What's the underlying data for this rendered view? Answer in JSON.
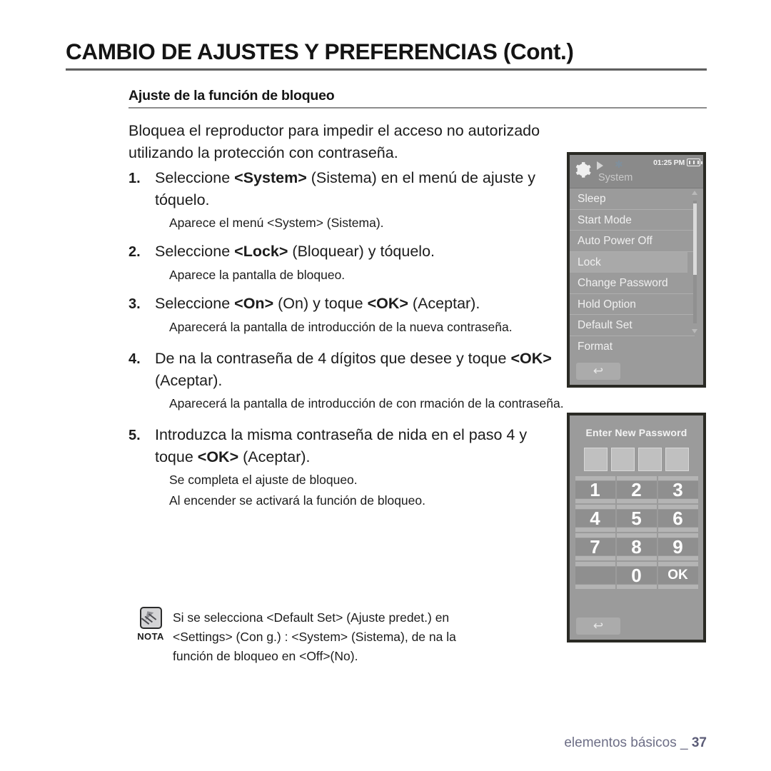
{
  "header": {
    "title": "CAMBIO DE AJUSTES Y PREFERENCIAS (Cont.)",
    "sub_heading": "Ajuste de la función de bloqueo"
  },
  "intro": "Bloquea el reproductor para impedir el acceso no autorizado utilizando la protección con contraseña.",
  "steps": [
    {
      "num": "1.",
      "text_1": "Seleccione ",
      "bold_1": "<System>",
      "text_2": " (Sistema) en el menú de ajuste y tóquelo.",
      "notes": [
        "Aparece el menú <System> (Sistema)."
      ]
    },
    {
      "num": "2.",
      "text_1": "Seleccione ",
      "bold_1": "<Lock>",
      "text_2": " (Bloquear) y tóquelo.",
      "notes": [
        "Aparece la pantalla de bloqueo."
      ]
    },
    {
      "num": "3.",
      "text_1": "Seleccione ",
      "bold_1": "<On>",
      "text_2": " (On) y toque ",
      "bold_2": "<OK>",
      "text_3": " (Aceptar).",
      "notes": [
        "Aparecerá la pantalla de introducción de la nueva contraseña."
      ]
    },
    {
      "num": "4.",
      "text_1": "De na la contraseña de 4 dígitos que desee y toque ",
      "bold_1": "<OK>",
      "text_2": " (Aceptar).",
      "notes": [
        "Aparecerá la pantalla de introducción de con rmación de la contraseña."
      ]
    },
    {
      "num": "5.",
      "text_1": "Introduzca la misma contraseña de nida en el paso 4 y toque ",
      "bold_1": "<OK>",
      "text_2": " (Aceptar).",
      "notes": [
        "Se completa el ajuste de bloqueo.",
        "Al encender se activará la función de bloqueo."
      ]
    }
  ],
  "note_block": {
    "icon": "note-hand-icon",
    "label": "NOTA",
    "line_1": "Si se selecciona <Default Set> (Ajuste predet.) en",
    "line_2": "<Settings> (Con g.)  :  <System> (Sistema), de na la",
    "line_3": "función de bloqueo en <Off>(No)."
  },
  "footer": {
    "text": "elementos básicos _",
    "page": "37",
    "color": "#6d6e86"
  },
  "device_menu": {
    "statusbar": {
      "gear_icon": "gear-icon",
      "play_icon": "play-icon",
      "bluetooth_icon": "bluetooth-icon",
      "time": "01:25 PM",
      "battery_icon": "battery-icon"
    },
    "screen_label": "System",
    "items": [
      {
        "label": "Sleep",
        "selected": false
      },
      {
        "label": "Start Mode",
        "selected": false
      },
      {
        "label": "Auto Power Off",
        "selected": false
      },
      {
        "label": "Lock",
        "selected": true
      },
      {
        "label": "Change Password",
        "selected": false
      },
      {
        "label": "Hold Option",
        "selected": false
      },
      {
        "label": "Default Set",
        "selected": false
      },
      {
        "label": "Format",
        "selected": false
      }
    ],
    "scroll_up_icon": "chevron-up-icon",
    "scroll_down_icon": "chevron-down-icon",
    "back_icon": "return-arrow-icon",
    "colors": {
      "screen_bg": "#9b9b9b",
      "statusbar_bg": "#8a8a8a",
      "highlight": "#a9a9a9"
    }
  },
  "device_pad": {
    "title": "Enter New Password",
    "password_boxes": [
      "",
      "",
      "",
      ""
    ],
    "keys": [
      "1",
      "2",
      "3",
      "4",
      "5",
      "6",
      "7",
      "8",
      "9",
      "",
      "0",
      "OK"
    ],
    "back_icon": "return-arrow-icon",
    "colors": {
      "screen_bg": "#9b9b9b",
      "key_bg": "#8f8f8f",
      "box_bg": "#c0c0c0"
    }
  }
}
